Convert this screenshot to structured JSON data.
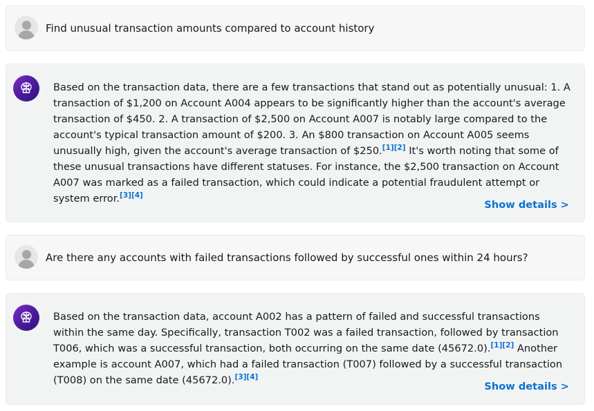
{
  "messages": [
    {
      "role": "user",
      "text": "Find unusual transaction amounts compared to account history"
    },
    {
      "role": "assistant",
      "part1": "Based on the transaction data, there are a few transactions that stand out as potentially unusual: 1. A transaction of $1,200 on Account A004 appears to be significantly higher than the account's average transaction of $450. 2. A transaction of $2,500 on Account A007 is notably large compared to the account's typical transaction amount of $200. 3. An $800 transaction on Account A005 seems unusually high, given the account's average transaction of $250.",
      "cite1": "[1]",
      "cite2": "[2]",
      "part2": " It's worth noting that some of these unusual transactions have different statuses. For instance, the $2,500 transaction on Account A007 was marked as a failed transaction, which could indicate a potential fraudulent attempt or system error.",
      "cite3": "[3]",
      "cite4": "[4]",
      "show_details": "Show details >"
    },
    {
      "role": "user",
      "text": "Are there any accounts with failed transactions followed by successful ones within 24 hours?"
    },
    {
      "role": "assistant",
      "part1": "Based on the transaction data, account A002 has a pattern of failed and successful transactions within the same day. Specifically, transaction T002 was a failed transaction, followed by transaction T006, which was a successful transaction, both occurring on the same date (45672.0).",
      "cite1": "[1]",
      "cite2": "[2]",
      "part2": " Another example is account A007, which had a failed transaction (T007) followed by a successful transaction (T008) on the same date (45672.0).",
      "cite3": "[3]",
      "cite4": "[4]",
      "show_details": "Show details >"
    }
  ],
  "colors": {
    "link": "#0972d3",
    "ai_avatar": "#5a1fb0",
    "card_bg": "#f2f3f3"
  },
  "icons": {
    "user_avatar": "user-avatar-icon",
    "ai_avatar": "ai-brain-icon"
  }
}
